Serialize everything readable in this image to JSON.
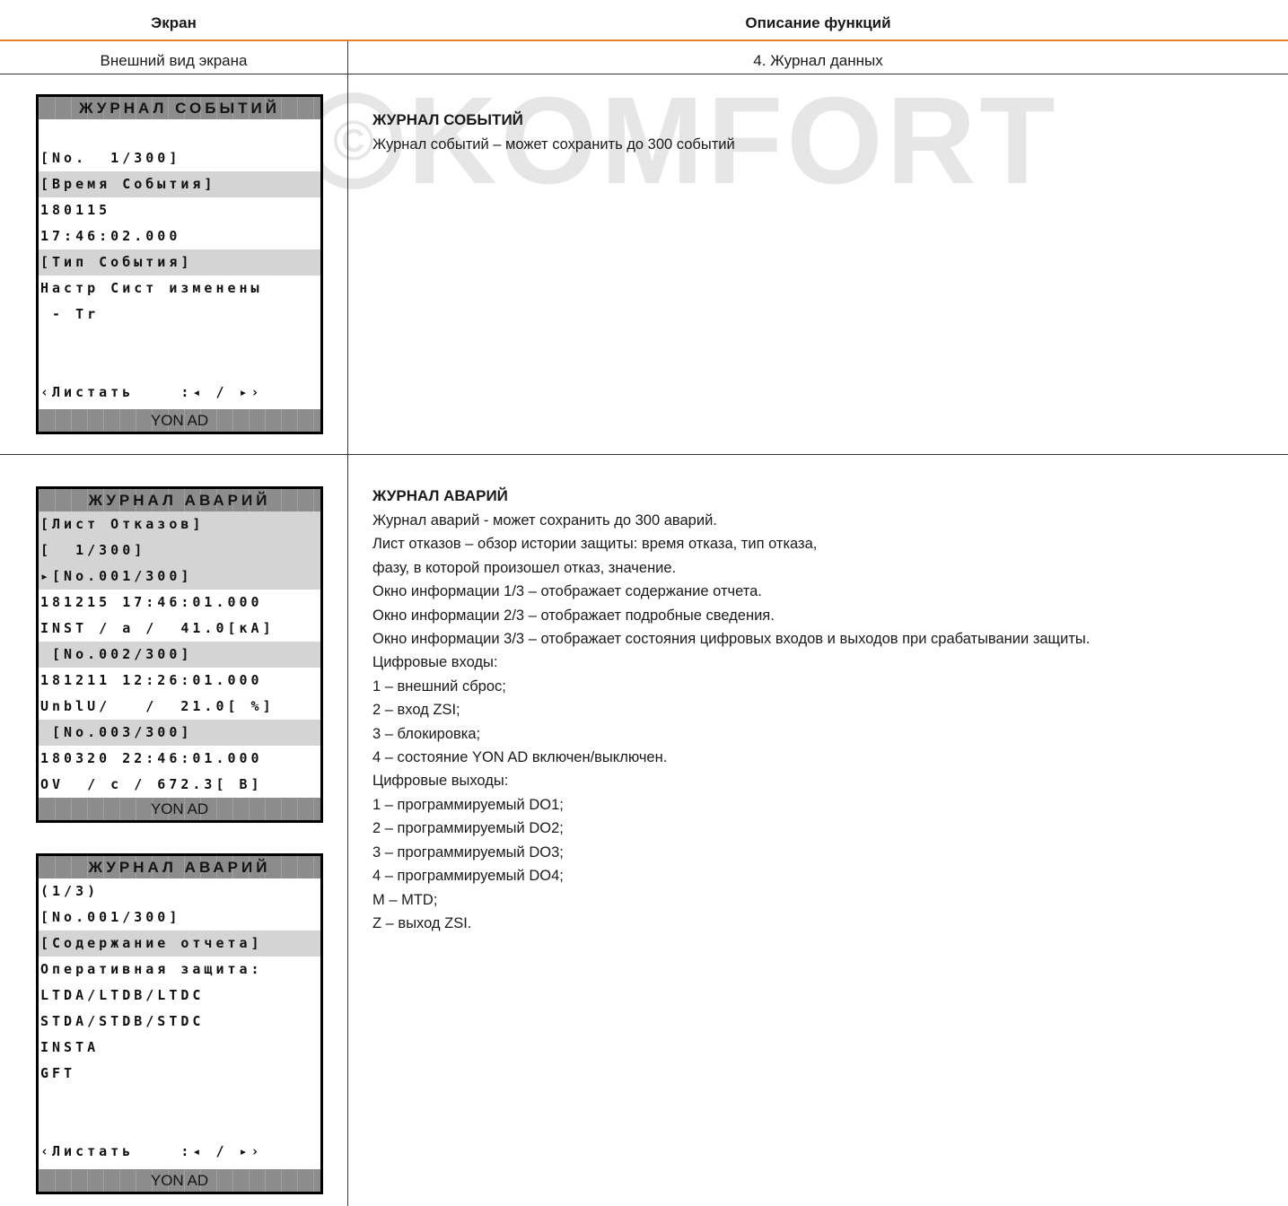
{
  "header": {
    "col_screen": "Экран",
    "col_desc": "Описание функций"
  },
  "subheader": {
    "col_screen": "Внешний вид экрана",
    "col_desc": "4. Журнал данных"
  },
  "watermark": {
    "symbol": "©",
    "text": "KOMFORT"
  },
  "screens": [
    {
      "title": "ЖУРНАЛ СОБЫТИЙ",
      "rows": [
        {
          "text": "",
          "shaded": false
        },
        {
          "text": "[No.  1/300]",
          "shaded": false
        },
        {
          "text": "[Время События]",
          "shaded": true
        },
        {
          "text": "180115",
          "shaded": false
        },
        {
          "text": "17:46:02.000",
          "shaded": false
        },
        {
          "text": "[Тип События]",
          "shaded": true
        },
        {
          "text": "Настр Сист изменены",
          "shaded": false
        },
        {
          "text": " - Tr",
          "shaded": false
        },
        {
          "text": "",
          "shaded": false
        },
        {
          "text": "",
          "shaded": false
        },
        {
          "text": "‹Листать    :◂ / ▸›",
          "shaded": false
        }
      ],
      "footer": "YON AD"
    },
    {
      "title": "ЖУРНАЛ АВАРИЙ",
      "rows": [
        {
          "text": "[Лист Отказов]",
          "shaded": true
        },
        {
          "text": "[  1/300]",
          "shaded": true
        },
        {
          "text": "▸[No.001/300]",
          "shaded": true
        },
        {
          "text": "181215 17:46:01.000",
          "shaded": false
        },
        {
          "text": "INST / a /  41.0[кA]",
          "shaded": false
        },
        {
          "text": " [No.002/300]",
          "shaded": true
        },
        {
          "text": "181211 12:26:01.000",
          "shaded": false
        },
        {
          "text": "UnblU/   /  21.0[ %]",
          "shaded": false
        },
        {
          "text": " [No.003/300]",
          "shaded": true
        },
        {
          "text": "180320 22:46:01.000",
          "shaded": false
        },
        {
          "text": "OV  / c / 672.3[ B]",
          "shaded": false
        }
      ],
      "footer": "YON AD"
    },
    {
      "title": "ЖУРНАЛ АВАРИЙ",
      "rows": [
        {
          "text": "(1/3)",
          "shaded": false
        },
        {
          "text": "[No.001/300]",
          "shaded": false
        },
        {
          "text": "[Содержание отчета]",
          "shaded": true
        },
        {
          "text": "Оперативная защита:",
          "shaded": false
        },
        {
          "text": "LTDA/LTDB/LTDC",
          "shaded": false
        },
        {
          "text": "STDA/STDB/STDC",
          "shaded": false
        },
        {
          "text": "INSTA",
          "shaded": false
        },
        {
          "text": "GFT",
          "shaded": false
        },
        {
          "text": "",
          "shaded": false
        },
        {
          "text": "",
          "shaded": false
        },
        {
          "text": "‹Листать    :◂ / ▸›",
          "shaded": false
        }
      ],
      "footer": "YON AD"
    }
  ],
  "descriptions": [
    {
      "title": "ЖУРНАЛ СОБЫТИЙ",
      "lines": [
        "Журнал событий – может сохранить до 300 событий"
      ]
    },
    {
      "title": "ЖУРНАЛ АВАРИЙ",
      "lines": [
        "Журнал аварий - может сохранить до 300 аварий.",
        "Лист отказов – обзор истории защиты: время отказа, тип отказа,",
        "фазу, в которой произошел отказ, значение.",
        "Окно  информации 1/3 – отображает содержание отчета.",
        "Окно информации 2/3 – отображает подробные сведения.",
        "Окно информации 3/3 – отображает состояния цифровых входов и выходов при срабатывании защиты.",
        "Цифровые входы:",
        "1 – внешний сброс;",
        "2 – вход ZSI;",
        "3 – блокировка;",
        "4  – состояние YON AD включен/выключен.",
        "Цифровые выходы:",
        "1 – программируемый DO1;",
        "2 – программируемый DO2;",
        "3 – программируемый DO3;",
        "4 – программируемый DO4;",
        "M – MTD;",
        "Z – выход ZSI."
      ]
    }
  ]
}
